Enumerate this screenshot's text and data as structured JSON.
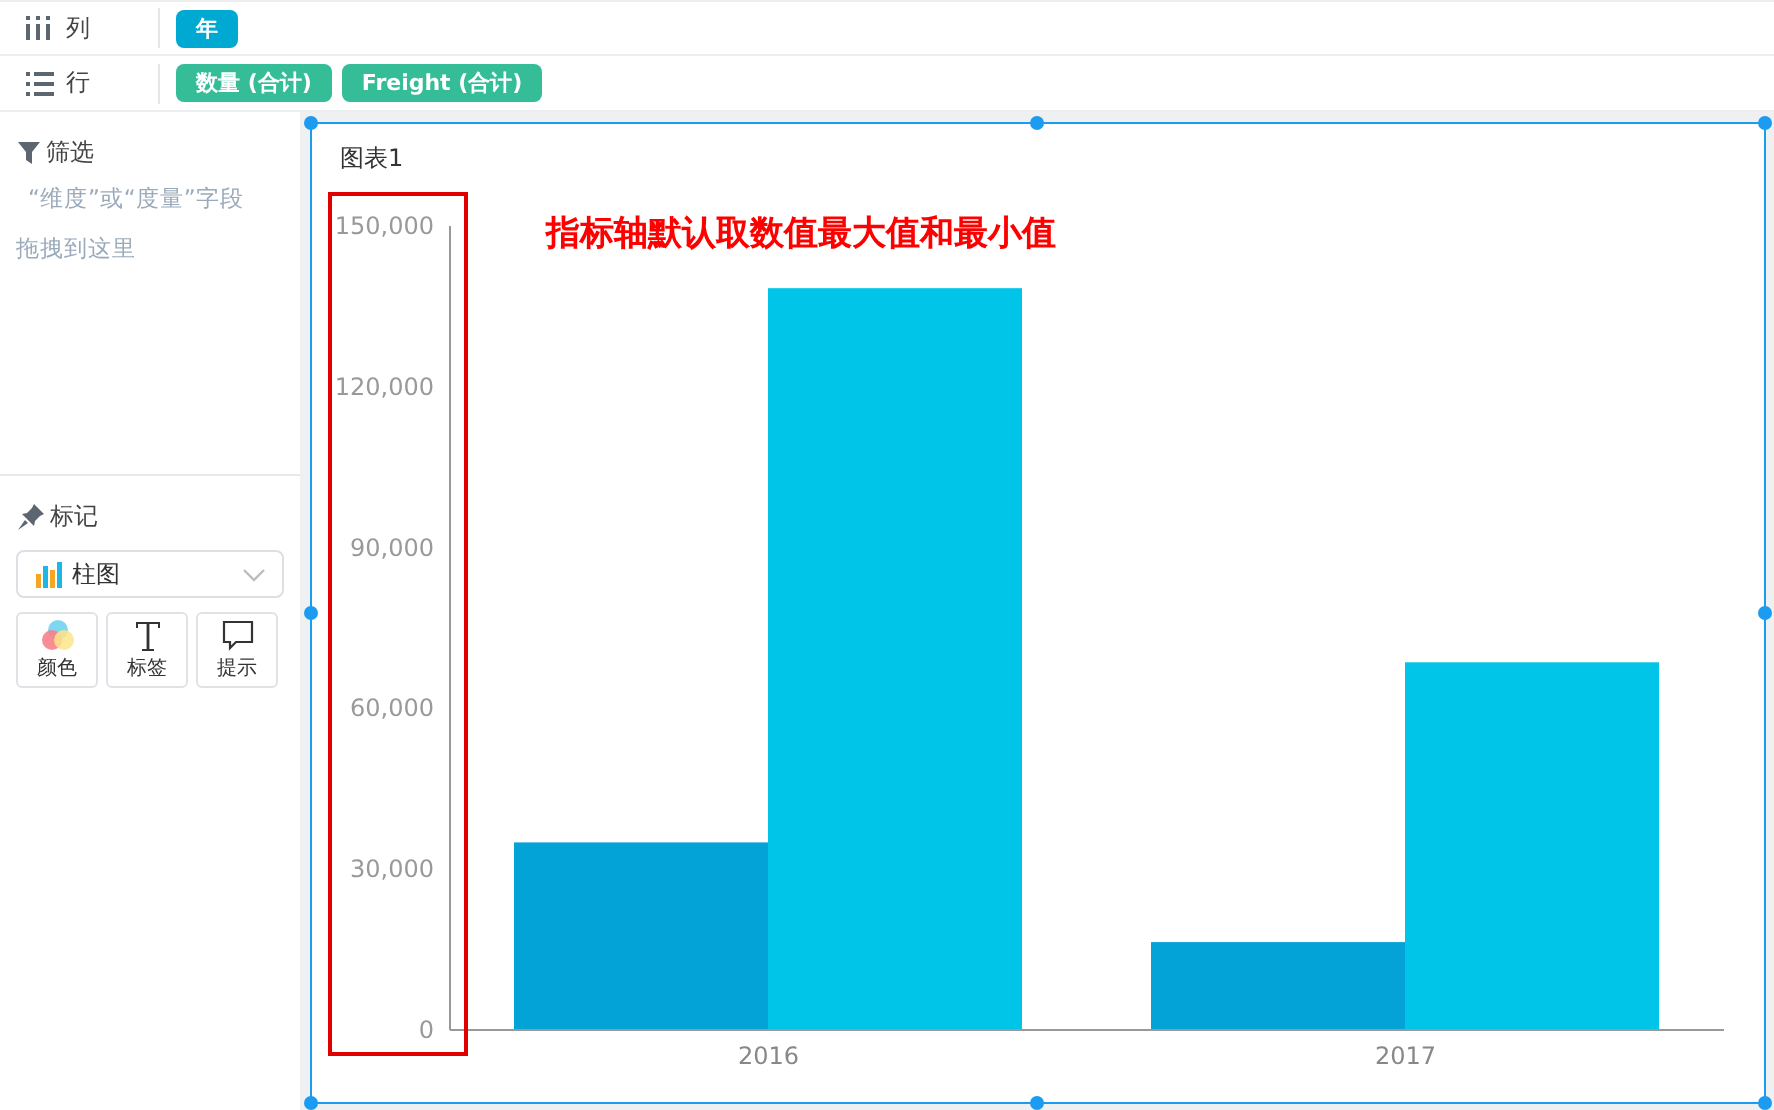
{
  "shelves": [
    {
      "kind": "columns",
      "label": "列",
      "pills": [
        {
          "text": "年",
          "kind": "dimension"
        }
      ]
    },
    {
      "kind": "rows",
      "label": "行",
      "pills": [
        {
          "text": "数量 (合计)",
          "kind": "measure"
        },
        {
          "text": "Freight (合计)",
          "kind": "measure"
        }
      ]
    }
  ],
  "filter": {
    "title": "筛选",
    "hint": "“维度”或“度量”字段拖拽到这里"
  },
  "marks": {
    "title": "标记",
    "chart_type": "柱图",
    "buttons": [
      {
        "kind": "color",
        "label": "颜色"
      },
      {
        "kind": "text",
        "label": "标签"
      },
      {
        "kind": "tooltip",
        "label": "提示"
      }
    ]
  },
  "chart": {
    "title": "图表1",
    "annotation": "指标轴默认取数值最大值和最小值",
    "selected": true,
    "chart_data": {
      "type": "bar",
      "categories": [
        "2016",
        "2017"
      ],
      "ylim": [
        0,
        150000
      ],
      "yticks": [
        {
          "value": 0,
          "label": "0"
        },
        {
          "value": 30000,
          "label": "30,000"
        },
        {
          "value": 60000,
          "label": "60,000"
        },
        {
          "value": 90000,
          "label": "90,000"
        },
        {
          "value": 120000,
          "label": "120,000"
        },
        {
          "value": 150000,
          "label": "150,000"
        }
      ],
      "series": [
        {
          "color": "#04a3d7",
          "values": [
            35000,
            16400
          ]
        },
        {
          "color": "#00c5e8",
          "values": [
            138400,
            68600
          ]
        }
      ]
    }
  }
}
